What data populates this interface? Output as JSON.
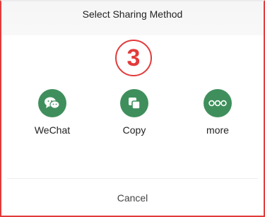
{
  "dialog": {
    "title": "Select Sharing Method",
    "step": "3"
  },
  "options": [
    {
      "label": "WeChat",
      "icon": "wechat-icon"
    },
    {
      "label": "Copy",
      "icon": "copy-icon"
    },
    {
      "label": "more",
      "icon": "more-icon"
    }
  ],
  "cancel_label": "Cancel",
  "colors": {
    "icon_bg": "#3f8f5c",
    "annotation": "#e23b3b"
  }
}
